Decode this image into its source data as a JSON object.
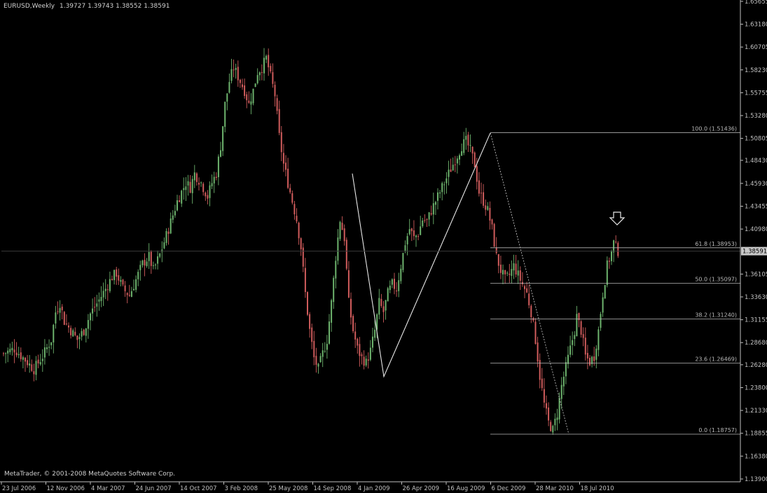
{
  "window": {
    "title": "EURUSD,Weekly",
    "ohlc": "1.39727 1.39743 1.38552 1.38591",
    "copyright": "MetaTrader, © 2001-2008 MetaQuotes Software Corp.",
    "current_price": "1.38591"
  },
  "colors": {
    "background": "#000000",
    "bull": "#6db36d",
    "bear": "#d05c5c",
    "axis": "#c0c0c0",
    "fib": "#b8b8b8",
    "price_marker": "#c8c8c8"
  },
  "chart_data": {
    "type": "candlestick",
    "symbol": "EURUSD",
    "timeframe": "Weekly",
    "y_ticks": [
      "1.65655",
      "1.63180",
      "1.60705",
      "1.58230",
      "1.55755",
      "1.53280",
      "1.50805",
      "1.48430",
      "1.45930",
      "1.43455",
      "1.40980",
      "1.38591",
      "1.36105",
      "1.33630",
      "1.31155",
      "1.28680",
      "1.26280",
      "1.23800",
      "1.21330",
      "1.18855",
      "1.16380",
      "1.13900"
    ],
    "ylim": [
      1.139,
      1.6565
    ],
    "x_ticks": [
      "23 Jul 2006",
      "12 Nov 2006",
      "4 Mar 2007",
      "24 Jun 2007",
      "14 Oct 2007",
      "3 Feb 2008",
      "25 May 2008",
      "14 Sep 2008",
      "4 Jan 2009",
      "26 Apr 2009",
      "16 Aug 2009",
      "6 Dec 2009",
      "28 Mar 2010",
      "18 Jul 2010"
    ],
    "price_path": [
      [
        0,
        1.275
      ],
      [
        5,
        1.28
      ],
      [
        10,
        1.268
      ],
      [
        14,
        1.258
      ],
      [
        18,
        1.272
      ],
      [
        22,
        1.29
      ],
      [
        24,
        1.32
      ],
      [
        26,
        1.33
      ],
      [
        28,
        1.31
      ],
      [
        31,
        1.3
      ],
      [
        34,
        1.29
      ],
      [
        37,
        1.3
      ],
      [
        40,
        1.318
      ],
      [
        44,
        1.333
      ],
      [
        47,
        1.345
      ],
      [
        50,
        1.358
      ],
      [
        52,
        1.362
      ],
      [
        55,
        1.345
      ],
      [
        58,
        1.338
      ],
      [
        61,
        1.355
      ],
      [
        64,
        1.372
      ],
      [
        67,
        1.38
      ],
      [
        69,
        1.365
      ],
      [
        72,
        1.382
      ],
      [
        76,
        1.41
      ],
      [
        80,
        1.44
      ],
      [
        84,
        1.46
      ],
      [
        86,
        1.455
      ],
      [
        88,
        1.47
      ],
      [
        91,
        1.46
      ],
      [
        94,
        1.445
      ],
      [
        96,
        1.46
      ],
      [
        98,
        1.47
      ],
      [
        100,
        1.5
      ],
      [
        102,
        1.545
      ],
      [
        104,
        1.57
      ],
      [
        106,
        1.585
      ],
      [
        108,
        1.575
      ],
      [
        111,
        1.56
      ],
      [
        113,
        1.545
      ],
      [
        115,
        1.56
      ],
      [
        117,
        1.58
      ],
      [
        119,
        1.585
      ],
      [
        121,
        1.595
      ],
      [
        123,
        1.575
      ],
      [
        125,
        1.555
      ],
      [
        127,
        1.51
      ],
      [
        129,
        1.48
      ],
      [
        131,
        1.46
      ],
      [
        133,
        1.44
      ],
      [
        135,
        1.42
      ],
      [
        137,
        1.39
      ],
      [
        139,
        1.34
      ],
      [
        141,
        1.3
      ],
      [
        143,
        1.27
      ],
      [
        145,
        1.258
      ],
      [
        147,
        1.275
      ],
      [
        149,
        1.29
      ],
      [
        151,
        1.33
      ],
      [
        153,
        1.38
      ],
      [
        155,
        1.42
      ],
      [
        157,
        1.4
      ],
      [
        159,
        1.33
      ],
      [
        161,
        1.3
      ],
      [
        163,
        1.28
      ],
      [
        165,
        1.27
      ],
      [
        167,
        1.265
      ],
      [
        169,
        1.278
      ],
      [
        171,
        1.3
      ],
      [
        173,
        1.33
      ],
      [
        175,
        1.32
      ],
      [
        177,
        1.34
      ],
      [
        179,
        1.35
      ],
      [
        181,
        1.345
      ],
      [
        183,
        1.37
      ],
      [
        185,
        1.395
      ],
      [
        187,
        1.41
      ],
      [
        189,
        1.4
      ],
      [
        191,
        1.405
      ],
      [
        193,
        1.42
      ],
      [
        195,
        1.418
      ],
      [
        197,
        1.43
      ],
      [
        199,
        1.44
      ],
      [
        201,
        1.45
      ],
      [
        203,
        1.46
      ],
      [
        205,
        1.47
      ],
      [
        207,
        1.48
      ],
      [
        209,
        1.49
      ],
      [
        211,
        1.5
      ],
      [
        213,
        1.505
      ],
      [
        215,
        1.495
      ],
      [
        217,
        1.48
      ],
      [
        219,
        1.45
      ],
      [
        221,
        1.44
      ],
      [
        223,
        1.43
      ],
      [
        225,
        1.41
      ],
      [
        227,
        1.38
      ],
      [
        229,
        1.365
      ],
      [
        231,
        1.355
      ],
      [
        233,
        1.36
      ],
      [
        235,
        1.37
      ],
      [
        237,
        1.36
      ],
      [
        239,
        1.35
      ],
      [
        241,
        1.34
      ],
      [
        243,
        1.32
      ],
      [
        245,
        1.29
      ],
      [
        247,
        1.25
      ],
      [
        249,
        1.22
      ],
      [
        251,
        1.2
      ],
      [
        253,
        1.192
      ],
      [
        255,
        1.21
      ],
      [
        257,
        1.24
      ],
      [
        259,
        1.26
      ],
      [
        261,
        1.28
      ],
      [
        263,
        1.3
      ],
      [
        264,
        1.315
      ],
      [
        266,
        1.3
      ],
      [
        268,
        1.272
      ],
      [
        270,
        1.266
      ],
      [
        272,
        1.272
      ],
      [
        274,
        1.3
      ],
      [
        276,
        1.34
      ],
      [
        278,
        1.37
      ],
      [
        280,
        1.385
      ],
      [
        281,
        1.395
      ],
      [
        283,
        1.386
      ]
    ],
    "zigzag": [
      [
        1.47,
        "4 Jan 2009",
        -12
      ],
      [
        1.25,
        "4 Jan 2009",
        8
      ],
      [
        1.514,
        "16 Aug 2009",
        8
      ]
    ],
    "fibonacci": {
      "levels": [
        {
          "label": "100.0 (1.51436)",
          "price": 1.51436
        },
        {
          "label": "61.8 (1.38953)",
          "price": 1.38953
        },
        {
          "label": "50.0 (1.35097)",
          "price": 1.35097
        },
        {
          "label": "38.2 (1.31240)",
          "price": 1.3124
        },
        {
          "label": "23.6 (1.26469)",
          "price": 1.26469
        },
        {
          "label": "0.0 (1.18757)",
          "price": 1.18757
        }
      ]
    }
  }
}
